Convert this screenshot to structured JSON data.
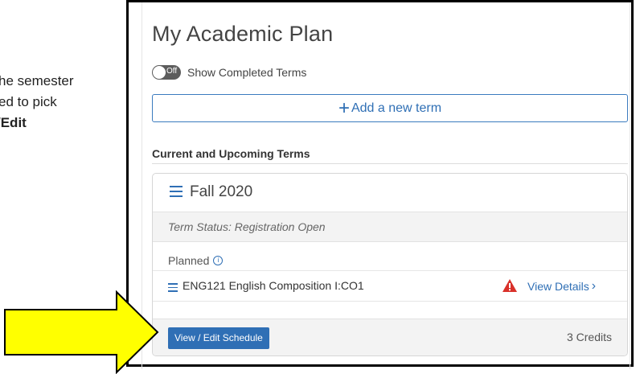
{
  "instructions": {
    "line1": "he semester",
    "line2": "ed to pick",
    "line3": "/Edit"
  },
  "plan": {
    "title": "My Academic Plan",
    "toggle_state": "Off",
    "toggle_label": "Show Completed Terms",
    "add_term_label": "Add a new term",
    "section_heading": "Current and Upcoming Terms"
  },
  "term": {
    "title": "Fall 2020",
    "status": "Term Status: Registration Open",
    "planned_label": "Planned",
    "courses": [
      {
        "name": "ENG121 English Composition I:CO1",
        "link": "View Details",
        "warning": true
      }
    ],
    "edit_button": "View / Edit Schedule",
    "credits": "3 Credits"
  },
  "colors": {
    "accent": "#2f6fb5",
    "warning": "#d9312a",
    "annotation_arrow": "#ffff00"
  },
  "icons": [
    "menu-icon",
    "plus-icon",
    "info-icon",
    "warning-icon",
    "chevron-right-icon",
    "toggle-switch"
  ]
}
